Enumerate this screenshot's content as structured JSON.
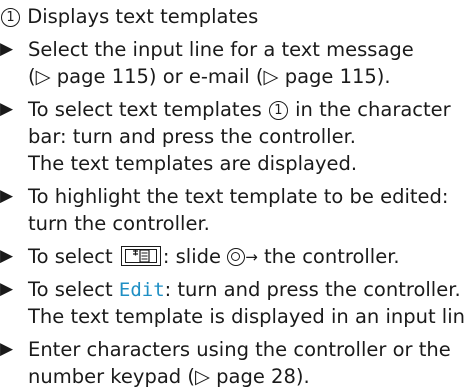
{
  "caption": {
    "number": "1",
    "text": " Displays text templates"
  },
  "steps": [
    {
      "lines": [
        "Select the input line for a text message",
        "(▷ page 115) or e-mail (▷ page 115)."
      ]
    },
    {
      "lines_a1": "To select text templates ",
      "num": "1",
      "lines_a2": " in the character",
      "lines": [
        "bar: turn and press the controller.",
        "The text templates are displayed."
      ]
    },
    {
      "lines": [
        "To highlight the text template to be edited:",
        "turn the controller."
      ]
    },
    {
      "pre": "To select ",
      "mid": ": slide ",
      "post": " the controller."
    },
    {
      "pre": "To select ",
      "term": "Edit",
      "post": ": turn and press the controller.",
      "line2": "The text template is displayed in an input line."
    },
    {
      "lines": [
        "Enter characters using the controller or the",
        "number keypad (▷ page 28)."
      ]
    }
  ],
  "bullet": "▶",
  "arrow": "→",
  "colors": {
    "text": "#1a1a1a",
    "menu_term": "#1f8fc4"
  },
  "icons": [
    "text-template-key-icon",
    "controller-icon",
    "slide-right-arrow-icon"
  ]
}
